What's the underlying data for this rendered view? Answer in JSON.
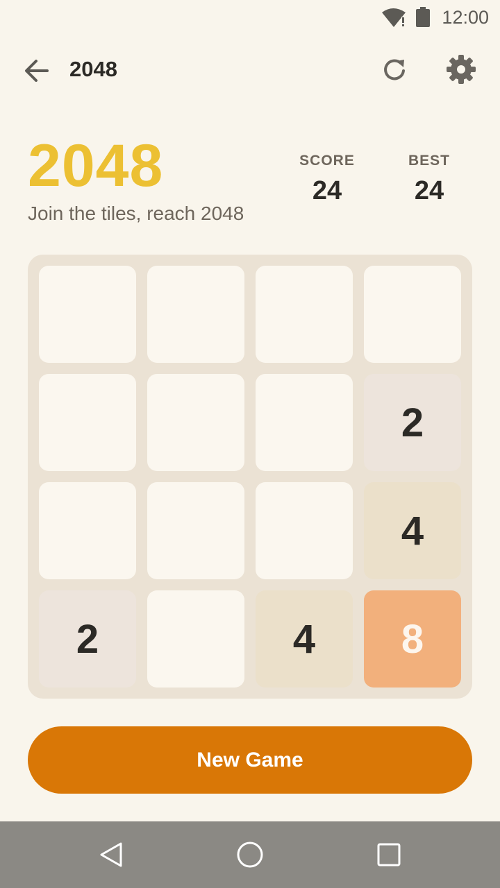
{
  "status_bar": {
    "time": "12:00",
    "icons": [
      "wifi-alert-icon",
      "battery-icon"
    ]
  },
  "app_bar": {
    "title": "2048",
    "icons": [
      "back-arrow-icon",
      "refresh-icon",
      "gear-icon"
    ]
  },
  "header": {
    "logo": "2048",
    "tagline": "Join the tiles, reach 2048",
    "score_label": "SCORE",
    "score_value": "24",
    "best_label": "BEST",
    "best_value": "24"
  },
  "board": {
    "rows": [
      [
        0,
        0,
        0,
        0
      ],
      [
        0,
        0,
        0,
        2
      ],
      [
        0,
        0,
        0,
        4
      ],
      [
        2,
        0,
        4,
        8
      ]
    ]
  },
  "actions": {
    "new_game_label": "New Game"
  },
  "colors": {
    "background": "#f9f5ec",
    "logo": "#ecc033",
    "board": "#ebe2d4",
    "tile_empty": "#fbf7ef",
    "tile_2": "#ede4dc",
    "tile_4": "#ebe0ca",
    "tile_8": "#f2b07c",
    "button": "#d97706",
    "nav_bar": "#8b8984"
  },
  "nav_bar": {
    "icons": [
      "nav-back-icon",
      "nav-home-icon",
      "nav-recents-icon"
    ]
  }
}
